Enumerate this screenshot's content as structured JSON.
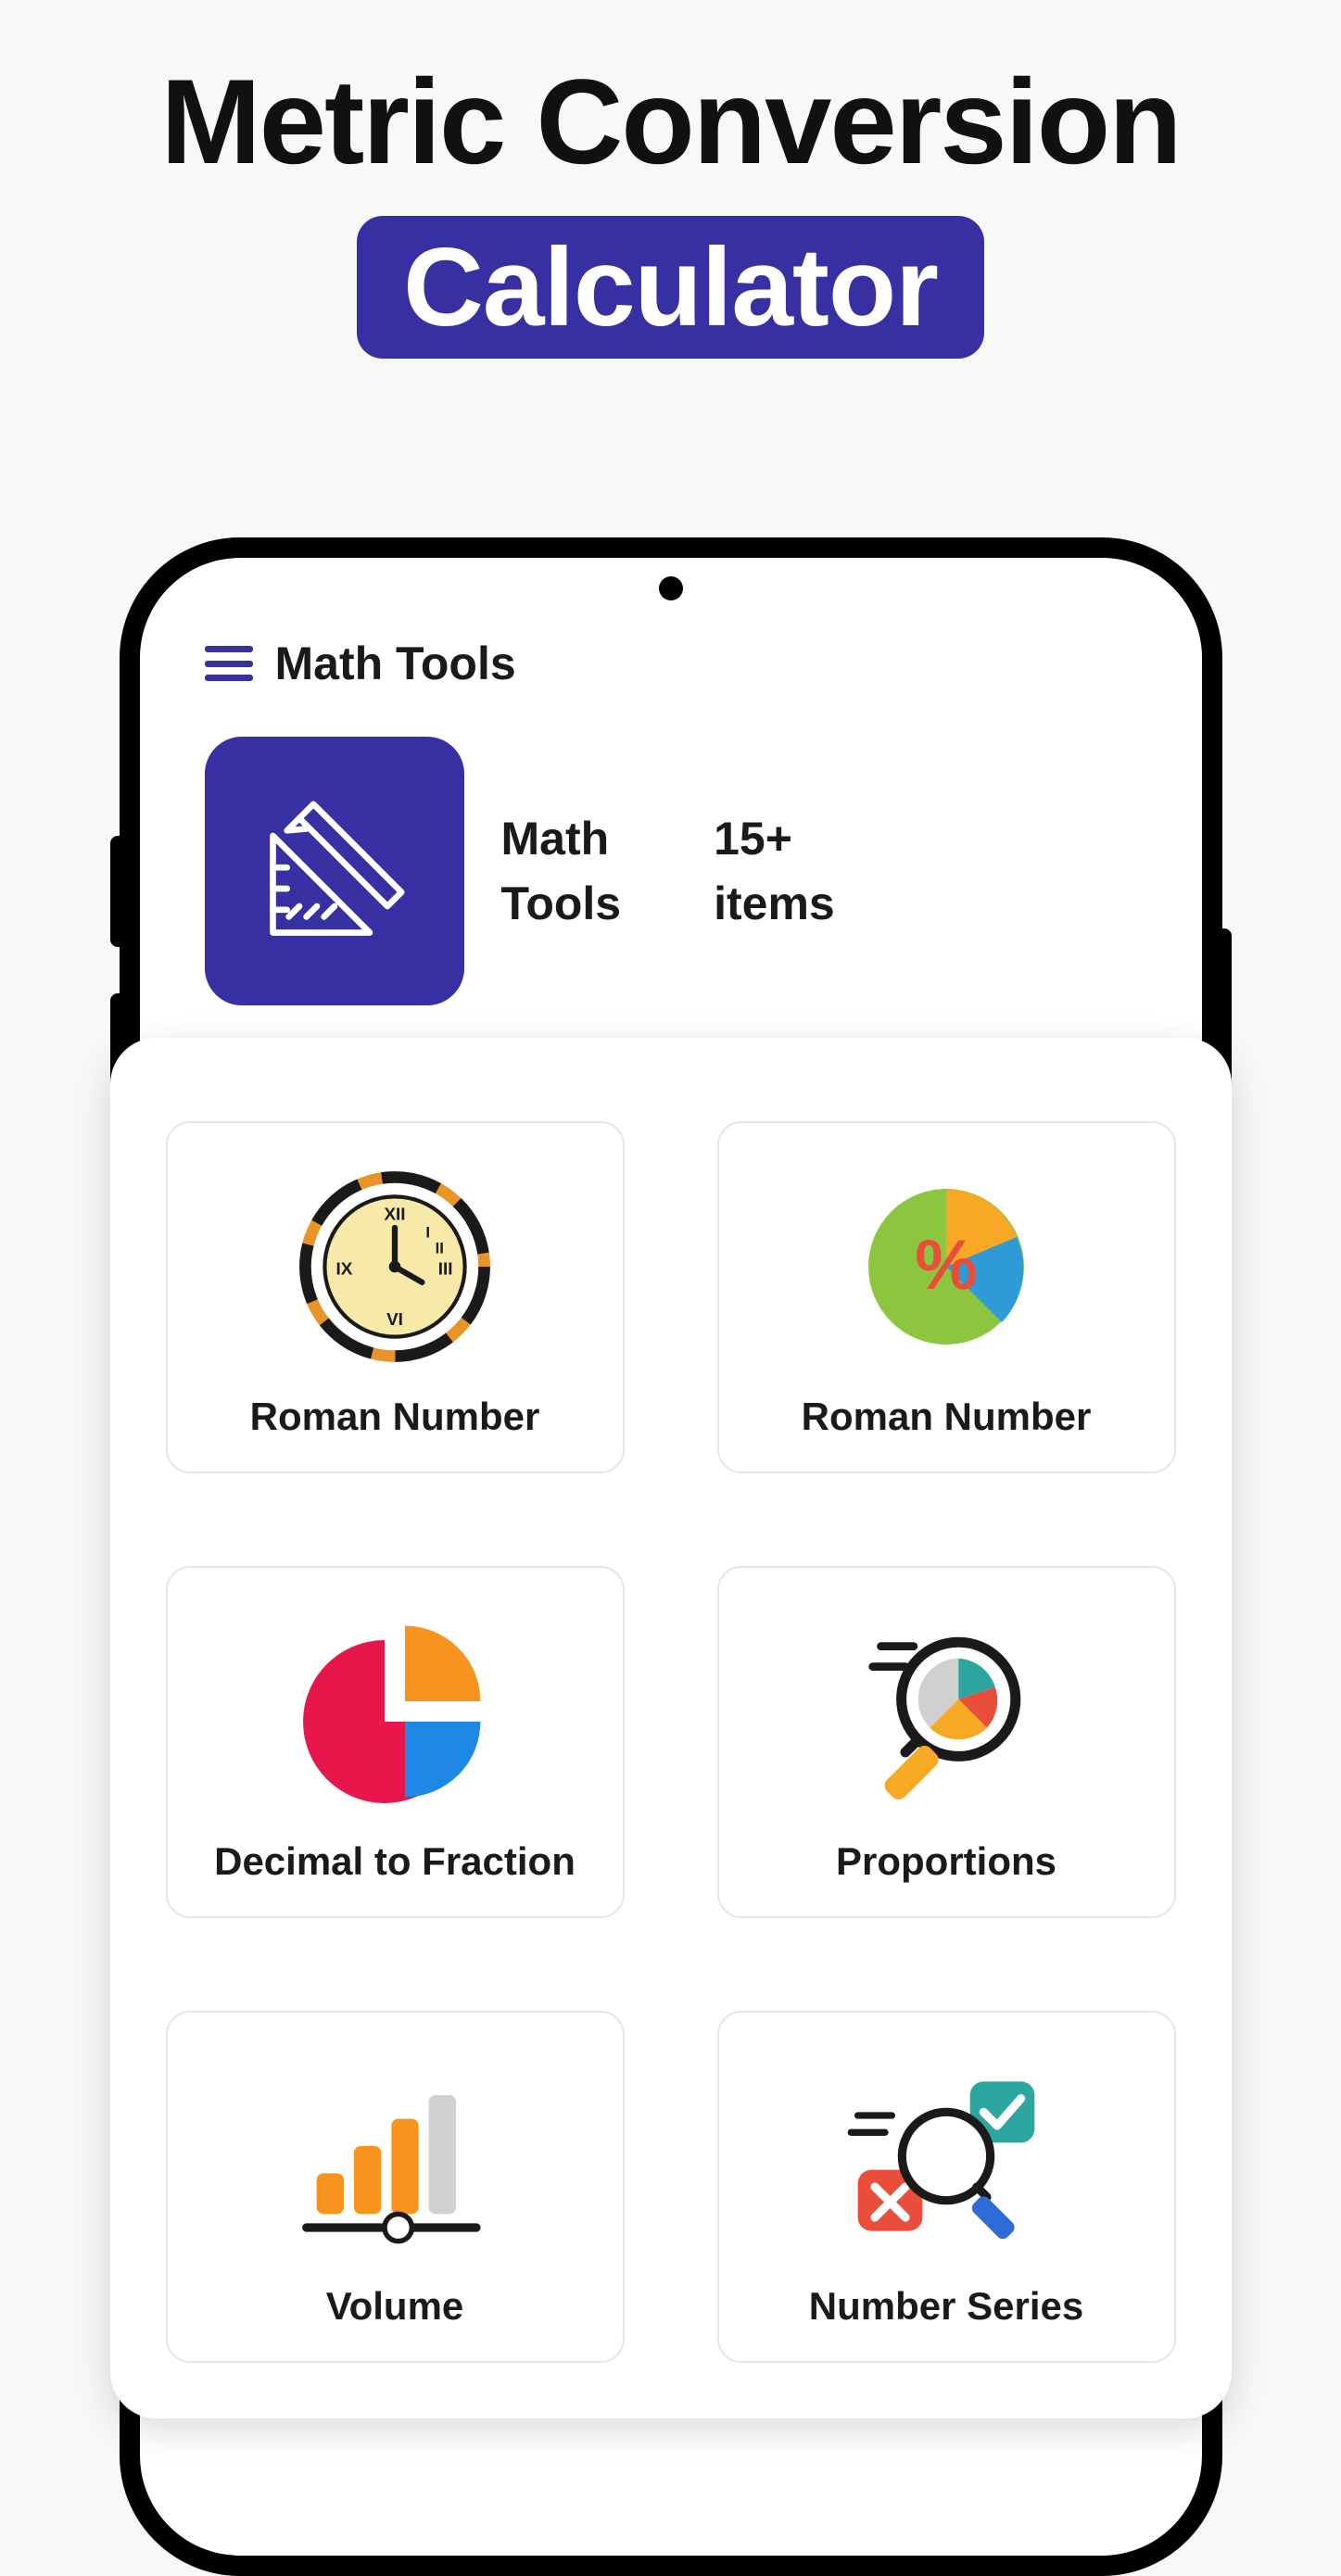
{
  "promo": {
    "title": "Metric Conversion",
    "badge": "Calculator"
  },
  "app": {
    "title": "Math Tools"
  },
  "category": {
    "name": "Math\nTools",
    "count": "15+\nitems",
    "icon": "ruler-triangle-icon"
  },
  "tools": [
    {
      "label": "Roman Number",
      "icon": "roman-clock-icon"
    },
    {
      "label": "Roman Number",
      "icon": "percent-pie-icon"
    },
    {
      "label": "Decimal to Fraction",
      "icon": "pie-chart-icon"
    },
    {
      "label": "Proportions",
      "icon": "magnify-chart-icon"
    },
    {
      "label": "Volume",
      "icon": "volume-bars-icon"
    },
    {
      "label": "Number Series",
      "icon": "check-cross-magnify-icon"
    }
  ]
}
